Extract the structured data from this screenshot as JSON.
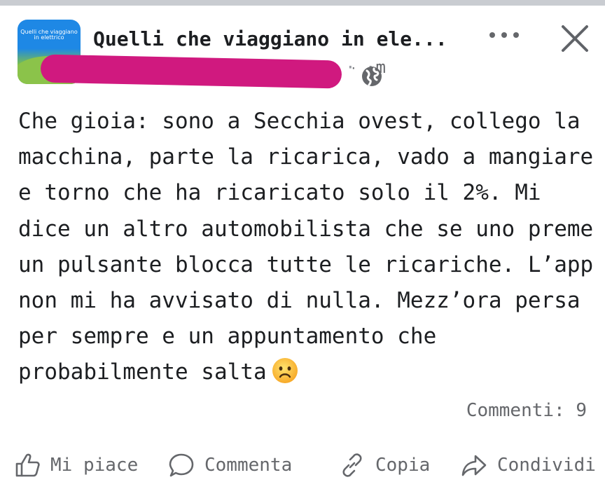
{
  "header": {
    "group_avatar_text": "Quelli che viaggiano in elettrico",
    "group_name": "Quelli che viaggiano in ele...",
    "meta_suffix": "m",
    "meta_separator": "·",
    "more_icon": "more-horizontal-icon",
    "close_icon": "close-icon",
    "privacy_icon": "globe-icon"
  },
  "post": {
    "lines": [
      "Che gioia: sono a Secchia ovest, collego la",
      "macchina, parte la ricarica, vado a mangiare",
      "e torno che ha ricaricato solo il 2%. Mi",
      "dice un altro automobilista che se uno preme",
      "un pulsante blocca tutte le ricariche. L’app",
      "non mi ha avvisato di nulla. Mezz’ora persa",
      "per sempre e un appuntamento che",
      "probabilmente salta"
    ],
    "emoji": "frowning-face"
  },
  "footer": {
    "comments_label": "Commenti: 9"
  },
  "actions": {
    "like_label": "Mi piace",
    "comment_label": "Commenta",
    "copy_label": "Copia",
    "share_label": "Condividi"
  },
  "colors": {
    "text": "#1c1e21",
    "secondary_text": "#65676b",
    "redaction": "#d0197f",
    "avatar_blue": "#1e88e5",
    "avatar_green": "#8bc34a"
  }
}
